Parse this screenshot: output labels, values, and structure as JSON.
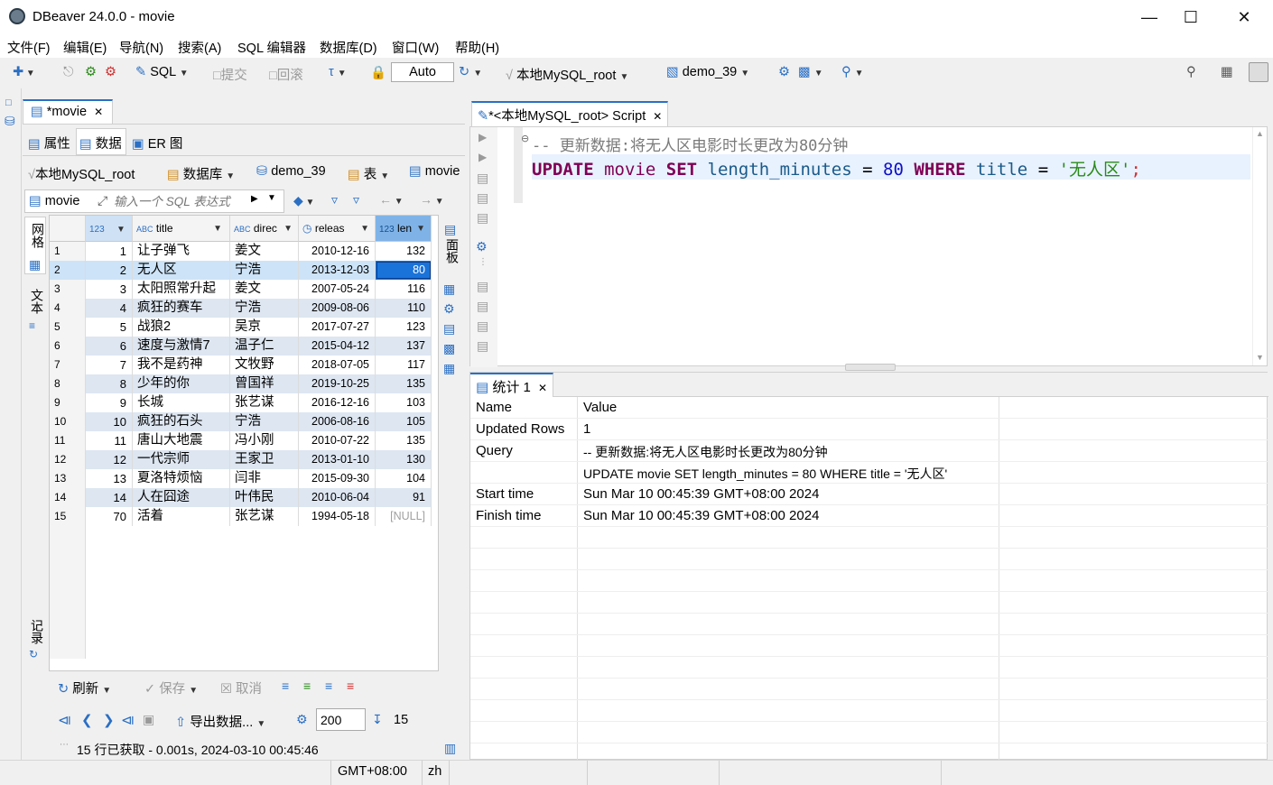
{
  "window": {
    "title": "DBeaver 24.0.0 - movie"
  },
  "menu": [
    "文件(F)",
    "编辑(E)",
    "导航(N)",
    "搜索(A)",
    "SQL 编辑器",
    "数据库(D)",
    "窗口(W)",
    "帮助(H)"
  ],
  "toolbar": {
    "sql_label": "SQL",
    "commit_label": "提交",
    "rollback_label": "回滚",
    "tx_mode": "Auto",
    "connection": "本地MySQL_root",
    "database": "demo_39"
  },
  "left_editor_tab": "*movie",
  "sub_tabs": {
    "properties": "属性",
    "data": "数据",
    "er": "ER 图"
  },
  "breadcrumb": {
    "connection": "本地MySQL_root",
    "databases": "数据库",
    "schema": "demo_39",
    "tables": "表",
    "table": "movie"
  },
  "filter": {
    "entity": "movie",
    "placeholder": "输入一个 SQL 表达式"
  },
  "side_labels": {
    "grid": "网格",
    "text": "文本",
    "records": "记录",
    "panels": "面板"
  },
  "columns": [
    {
      "label": "123",
      "w": 0
    },
    {
      "label": "title"
    },
    {
      "label": "direc"
    },
    {
      "label": "releas"
    },
    {
      "label": "len"
    }
  ],
  "rows": [
    {
      "n": "1",
      "id": "1",
      "title": "让子弹飞",
      "director": "姜文",
      "release": "2010-12-16",
      "len": "132"
    },
    {
      "n": "2",
      "id": "2",
      "title": "无人区",
      "director": "宁浩",
      "release": "2013-12-03",
      "len": "80"
    },
    {
      "n": "3",
      "id": "3",
      "title": "太阳照常升起",
      "director": "姜文",
      "release": "2007-05-24",
      "len": "116"
    },
    {
      "n": "4",
      "id": "4",
      "title": "疯狂的赛车",
      "director": "宁浩",
      "release": "2009-08-06",
      "len": "110"
    },
    {
      "n": "5",
      "id": "5",
      "title": "战狼2",
      "director": "吴京",
      "release": "2017-07-27",
      "len": "123"
    },
    {
      "n": "6",
      "id": "6",
      "title": "速度与激情7",
      "director": "温子仁",
      "release": "2015-04-12",
      "len": "137"
    },
    {
      "n": "7",
      "id": "7",
      "title": "我不是药神",
      "director": "文牧野",
      "release": "2018-07-05",
      "len": "117"
    },
    {
      "n": "8",
      "id": "8",
      "title": "少年的你",
      "director": "曾国祥",
      "release": "2019-10-25",
      "len": "135"
    },
    {
      "n": "9",
      "id": "9",
      "title": "长城",
      "director": "张艺谋",
      "release": "2016-12-16",
      "len": "103"
    },
    {
      "n": "10",
      "id": "10",
      "title": "疯狂的石头",
      "director": "宁浩",
      "release": "2006-08-16",
      "len": "105"
    },
    {
      "n": "11",
      "id": "11",
      "title": "唐山大地震",
      "director": "冯小刚",
      "release": "2010-07-22",
      "len": "135"
    },
    {
      "n": "12",
      "id": "12",
      "title": "一代宗师",
      "director": "王家卫",
      "release": "2013-01-10",
      "len": "130"
    },
    {
      "n": "13",
      "id": "13",
      "title": "夏洛特烦恼",
      "director": "闫非",
      "release": "2015-09-30",
      "len": "104"
    },
    {
      "n": "14",
      "id": "14",
      "title": "人在囧途",
      "director": "叶伟民",
      "release": "2010-06-04",
      "len": "91"
    },
    {
      "n": "15",
      "id": "70",
      "title": "活着",
      "director": "张艺谋",
      "release": "1994-05-18",
      "len": "[NULL]"
    }
  ],
  "bottom_toolbar": {
    "refresh": "刷新",
    "save": "保存",
    "cancel": "取消",
    "export": "导出数据...",
    "fetch_size": "200",
    "row_count": "15"
  },
  "status_line": "15 行已获取 - 0.001s, 2024-03-10 00:45:46",
  "script_tab": "*<本地MySQL_root> Script",
  "code": {
    "comment": "-- 更新数据:将无人区电影时长更改为80分钟",
    "kw_update": "UPDATE",
    "table": "movie",
    "kw_set": "SET",
    "col": "length_minutes",
    "eq": "=",
    "num": "80",
    "kw_where": "WHERE",
    "col2": "title",
    "eq2": "=",
    "str": "'无人区'",
    "semi": ";"
  },
  "results_tab": "统计 1",
  "results": [
    {
      "name": "Name",
      "value": "Value"
    },
    {
      "name": "Updated Rows",
      "value": "1"
    },
    {
      "name": "Query",
      "value": "-- 更新数据:将无人区电影时长更改为80分钟"
    },
    {
      "name": "",
      "value": "UPDATE movie SET length_minutes = 80 WHERE title = '无人区'"
    },
    {
      "name": "Start time",
      "value": "Sun Mar 10 00:45:39 GMT+08:00 2024"
    },
    {
      "name": "Finish time",
      "value": "Sun Mar 10 00:45:39 GMT+08:00 2024"
    }
  ],
  "statusbar": {
    "tz": "GMT+08:00",
    "locale": "zh"
  },
  "colors": {
    "selection": "#cde3f7",
    "selected_cell": "#1a73d9",
    "keyword": "#7f0055",
    "string": "#2a8a1a",
    "number": "#1010c8",
    "comment": "#7a7a7a"
  }
}
